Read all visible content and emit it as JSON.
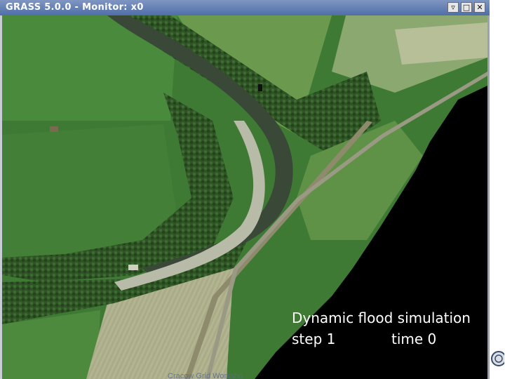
{
  "window": {
    "title": "GRASS 5.0.0 - Monitor: x0",
    "buttons": {
      "minimize_icon": "down-triangle",
      "maximize_icon": "square",
      "close_icon": "x"
    }
  },
  "simulation": {
    "title": "Dynamic flood simulation",
    "step_label": "step 1",
    "time_label": "time 0"
  },
  "footer": {
    "text": "Cracow Grid Worksho"
  },
  "colors": {
    "titlebar": "#5f7cb4",
    "water_mask": "#000000",
    "field_green": "#3f7a35",
    "forest": "#2c4f24",
    "river": "#3b4a3a",
    "gravel": "#b9bba9",
    "field_tan": "#a8a882"
  }
}
